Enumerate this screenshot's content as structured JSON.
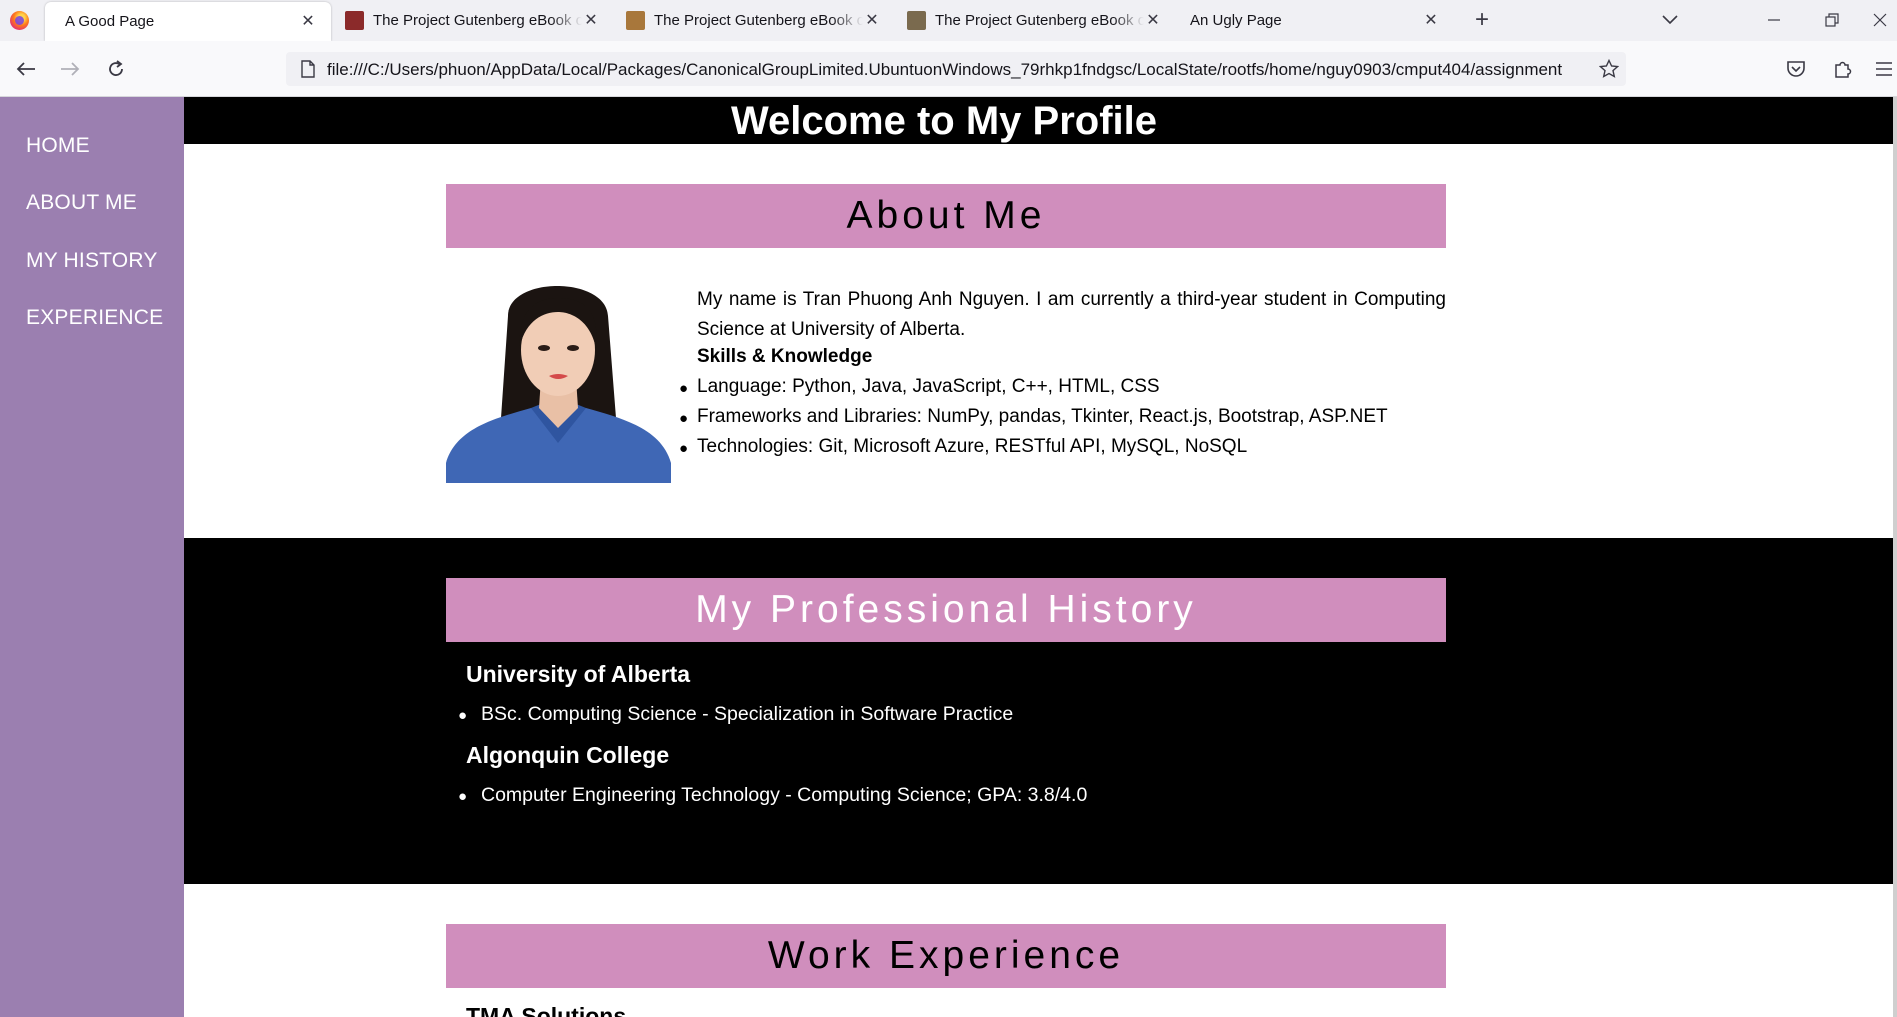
{
  "browser": {
    "tabs": [
      {
        "title": "A Good Page",
        "active": true
      },
      {
        "title": "The Project Gutenberg eBook of",
        "favicon_color": "#8b2a2a"
      },
      {
        "title": "The Project Gutenberg eBook of",
        "favicon_color": "#a8773b"
      },
      {
        "title": "The Project Gutenberg eBook of",
        "favicon_color": "#7a6a4e"
      },
      {
        "title": "An Ugly Page"
      }
    ],
    "url": "file:///C:/Users/phuon/AppData/Local/Packages/CanonicalGroupLimited.UbuntuonWindows_79rhkp1fndgsc/LocalState/rootfs/home/nguy0903/cmput404/assignment"
  },
  "page": {
    "title": "Welcome to My Profile",
    "sidebar": [
      "HOME",
      "ABOUT ME",
      "MY HISTORY",
      "EXPERIENCE"
    ],
    "about": {
      "heading": "About Me",
      "intro": "My name is Tran Phuong Anh Nguyen. I am currently a third-year student in Computing Science at University of Alberta.",
      "skills_title": "Skills & Knowledge",
      "skills": [
        "Language: Python, Java, JavaScript, C++, HTML, CSS",
        "Frameworks and Libraries: NumPy, pandas, Tkinter, React.js, Bootstrap, ASP.NET",
        "Technologies: Git, Microsoft Azure, RESTful API, MySQL, NoSQL"
      ]
    },
    "history": {
      "heading": "My Professional History",
      "entries": [
        {
          "institution": "University of Alberta",
          "detail": "BSc. Computing Science - Specialization in Software Practice"
        },
        {
          "institution": "Algonquin College",
          "detail": "Computer Engineering Technology - Computing Science; GPA: 3.8/4.0"
        }
      ]
    },
    "work": {
      "heading": "Work Experience",
      "first_item": "TMA Solutions"
    }
  },
  "colors": {
    "sidebar": "#9b7fb0",
    "section_heading": "#d08ebd",
    "dark_band": "#000000"
  }
}
